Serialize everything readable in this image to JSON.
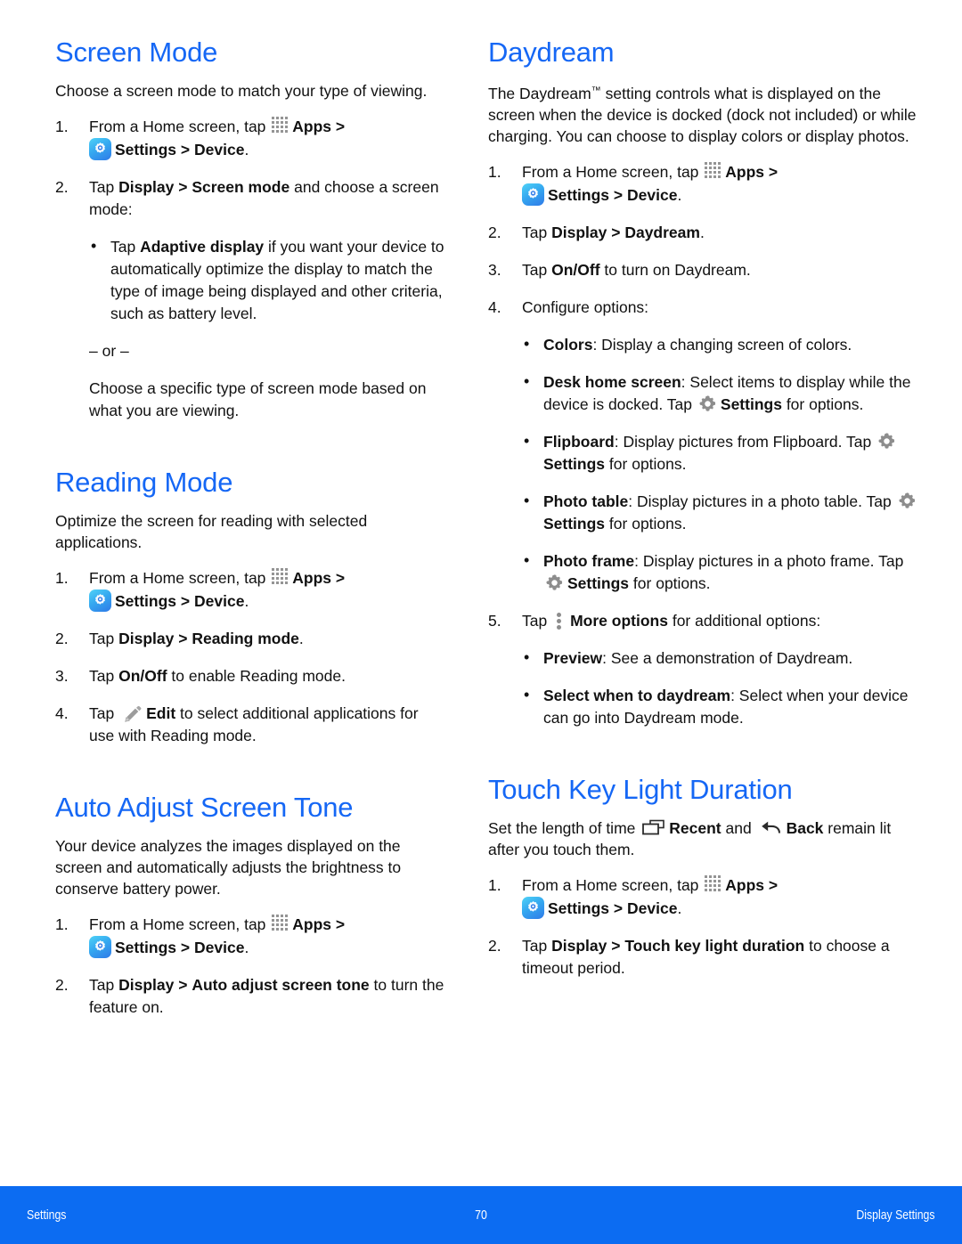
{
  "document": {
    "page_number": "70",
    "footer_left": "Settings",
    "footer_right": "Display Settings",
    "accent_heading_color": "#1567f5",
    "footer_bar_color": "#0c6cf2"
  },
  "icons": {
    "apps": "apps-grid-icon",
    "settings_app": "settings-app-icon",
    "gear": "gear-icon",
    "more_options": "more-options-icon",
    "pencil": "pencil-edit-icon",
    "recent": "recent-apps-icon",
    "back": "back-arrow-icon"
  },
  "left_column": {
    "screen_mode": {
      "title": "Screen Mode",
      "intro": "Choose a screen mode to match your type of viewing.",
      "step1_num": "1.",
      "step1_a": "From a Home screen, tap",
      "step1_apps": "Apps",
      "step1_gt1": ">",
      "step1_settings": "Settings",
      "step1_gt2": ">",
      "step1_device": "Device",
      "step1_period": ".",
      "step2_num": "2.",
      "step2_a": "Tap",
      "step2_display": "Display",
      "step2_gt": ">",
      "step2_screen_mode": "Screen mode",
      "step2_b": "and choose a screen mode:",
      "bullet1_bold": "Adaptive display",
      "bullet1_pre": "Tap",
      "bullet1_rest": "if you want your device to automatically optimize the display to match the type of image being displayed and other criteria, such as battery level.",
      "or_divider": "– or –",
      "closing": "Choose a specific type of screen mode based on what you are viewing."
    },
    "reading_mode": {
      "title": "Reading Mode",
      "intro": "Optimize the screen for reading with selected applications.",
      "step1_num": "1.",
      "step1_a": "From a Home screen, tap",
      "step1_apps": "Apps",
      "step1_gt1": ">",
      "step1_settings": "Settings",
      "step1_gt2": ">",
      "step1_device": "Device",
      "step1_period": ".",
      "step2_num": "2.",
      "step2_a": "Tap",
      "step2_display": "Display",
      "step2_gt": ">",
      "step2_reading_mode": "Reading mode",
      "step2_period": ".",
      "step3_num": "3.",
      "step3_a": "Tap",
      "step3_onoff": "On/Off",
      "step3_b": "to enable Reading mode.",
      "step4_num": "4.",
      "step4_a": "Tap",
      "step4_edit": "Edit",
      "step4_b": "to select additional applications for use with Reading mode."
    },
    "auto_adjust": {
      "title": "Auto Adjust Screen Tone",
      "intro": "Your device analyzes the images displayed on the screen and automatically adjusts the brightness to conserve battery power.",
      "step1_num": "1.",
      "step1_a": "From a Home screen, tap",
      "step1_apps": "Apps",
      "step1_gt1": ">",
      "step1_settings": "Settings",
      "step1_gt2": ">",
      "step1_device": "Device",
      "step1_period": ".",
      "step2_num": "2.",
      "step2_a": "Tap",
      "step2_display": "Display",
      "step2_gt": ">",
      "step2_auto": "Auto adjust screen tone",
      "step2_b": "to turn the feature on."
    }
  },
  "right_column": {
    "daydream": {
      "title": "Daydream",
      "intro_pre": "The Daydream",
      "intro_tm": "™",
      "intro_rest": " setting controls what is displayed on the screen when the device is docked (dock not included) or while charging. You can choose to display colors or display photos.",
      "step1_num": "1.",
      "step1_a": "From a Home screen, tap",
      "step1_apps": "Apps",
      "step1_gt1": ">",
      "step1_settings": "Settings",
      "step1_gt2": ">",
      "step1_device": "Device",
      "step1_period": ".",
      "step2_num": "2.",
      "step2_a": "Tap",
      "step2_display": "Display",
      "step2_gt": ">",
      "step2_daydream": "Daydream",
      "step2_period": ".",
      "step3_num": "3.",
      "step3_a": "Tap",
      "step3_onoff": "On/Off",
      "step3_b": "to turn on Daydream.",
      "step4_num": "4.",
      "step4_a": "Configure options:",
      "opt_colors_bold": "Colors",
      "opt_colors_rest": ": Display a changing screen of colors.",
      "opt_desk_bold": "Desk home screen",
      "opt_desk_mid": ": Select items to display while the device is docked. Tap",
      "opt_desk_settings": "Settings",
      "opt_desk_end": "for options.",
      "opt_flip_bold": "Flipboard",
      "opt_flip_mid": ": Display pictures from Flipboard. Tap",
      "opt_flip_settings": "Settings",
      "opt_flip_end": "for options.",
      "opt_ptable_bold": "Photo table",
      "opt_ptable_mid": ": Display pictures in a photo table. Tap",
      "opt_ptable_settings": "Settings",
      "opt_ptable_end": "for options.",
      "opt_pframe_bold": "Photo frame",
      "opt_pframe_mid": ": Display pictures in a photo frame. Tap",
      "opt_pframe_settings": "Settings",
      "opt_pframe_end": "for options.",
      "step5_num": "5.",
      "step5_a": "Tap",
      "step5_more": "More options",
      "step5_b": "for additional options:",
      "opt_preview_bold": "Preview",
      "opt_preview_rest": ": See a demonstration of Daydream.",
      "opt_select_bold": "Select when to daydream",
      "opt_select_rest": ": Select when your device can go into Daydream mode."
    },
    "touch_key": {
      "title": "Touch Key Light Duration",
      "intro_a": "Set the length of time",
      "intro_recent": "Recent",
      "intro_and": "and",
      "intro_back": "Back",
      "intro_b": "remain lit after you touch them.",
      "step1_num": "1.",
      "step1_a": "From a Home screen, tap",
      "step1_apps": "Apps",
      "step1_gt1": ">",
      "step1_settings": "Settings",
      "step1_gt2": ">",
      "step1_device": "Device",
      "step1_period": ".",
      "step2_num": "2.",
      "step2_a": "Tap",
      "step2_display": "Display",
      "step2_gt": ">",
      "step2_touch": "Touch key light duration",
      "step2_b": "to choose a timeout period."
    }
  }
}
